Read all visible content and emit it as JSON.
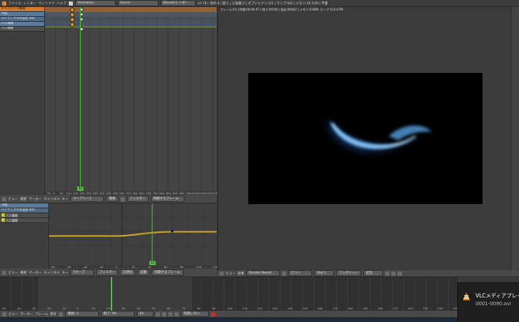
{
  "top_menu": {
    "items": [
      "ファイル",
      "レンダー",
      "ウィンドウ",
      "ヘルプ"
    ],
    "screen": "Animation",
    "scene": "Scene",
    "engine": "Blenderレンダー",
    "info": "v2.78 | 頂点:4 | 面:1 | 三角面:2 | オブジェクト:1/1 | ランプ:0/0 | メモリ:18.12M | 平面"
  },
  "dopesheet": {
    "channels": [
      "ドープシート概要",
      "平面",
      "パーティクルの設定.001",
      "パス補間",
      "パス補間"
    ],
    "ticks": [
      "-50",
      "0",
      "50",
      "100",
      "150",
      "200",
      "250",
      "300",
      "350",
      "400",
      "450",
      "500",
      "550",
      "600",
      "650",
      "700",
      "750",
      "800",
      "850",
      "900",
      "950",
      "1000",
      "1050",
      "1100",
      "1150",
      "1200"
    ],
    "current_frame": "43",
    "header": [
      "ビュー",
      "選択",
      "マーカー",
      "チャンネル",
      "キー",
      "ドープシート",
      "概要",
      "フィルター",
      "同期するフレーム"
    ]
  },
  "graph": {
    "channels": [
      "平面",
      "パーティクルの設定.001",
      "パス補間",
      "パス補間"
    ],
    "ticks": [
      "-80",
      "-60",
      "-40",
      "-20",
      "0",
      "20",
      "40",
      "60",
      "80",
      "100",
      "120"
    ],
    "current_frame": "43",
    "header": [
      "ビュー",
      "選択",
      "マーカー",
      "チャンネル",
      "キー",
      "Fカーブ",
      "フィルター",
      "正規化",
      "自動",
      "同期するフレーム"
    ]
  },
  "render": {
    "status": "フレーム:43 | 時間:00:00.07 | 残り:00:00 | 見出:00002 | メモリ:9.66M, ピーク:114.67M",
    "header": [
      "ビュー",
      "画像",
      "Render Result",
      "ビュー",
      "Slot 1",
      "コンポジット",
      "結合"
    ]
  },
  "timeline": {
    "ticks": [
      "-50",
      "-40",
      "-30",
      "-20",
      "-10",
      "0",
      "10",
      "20",
      "30",
      "40",
      "50",
      "60",
      "70",
      "80",
      "90",
      "100",
      "110",
      "120",
      "130",
      "140",
      "150",
      "160",
      "170",
      "180",
      "190",
      "200",
      "210",
      "220",
      "230",
      "240",
      "250"
    ],
    "header": [
      "ビュー",
      "マーカー",
      "フレーム",
      "再生",
      "開始:",
      "1",
      "終了:",
      "90",
      "43",
      "同期しない"
    ]
  },
  "notification": {
    "title": "VLCメディアプレイヤー",
    "subtitle": "0001-0090.avi"
  }
}
